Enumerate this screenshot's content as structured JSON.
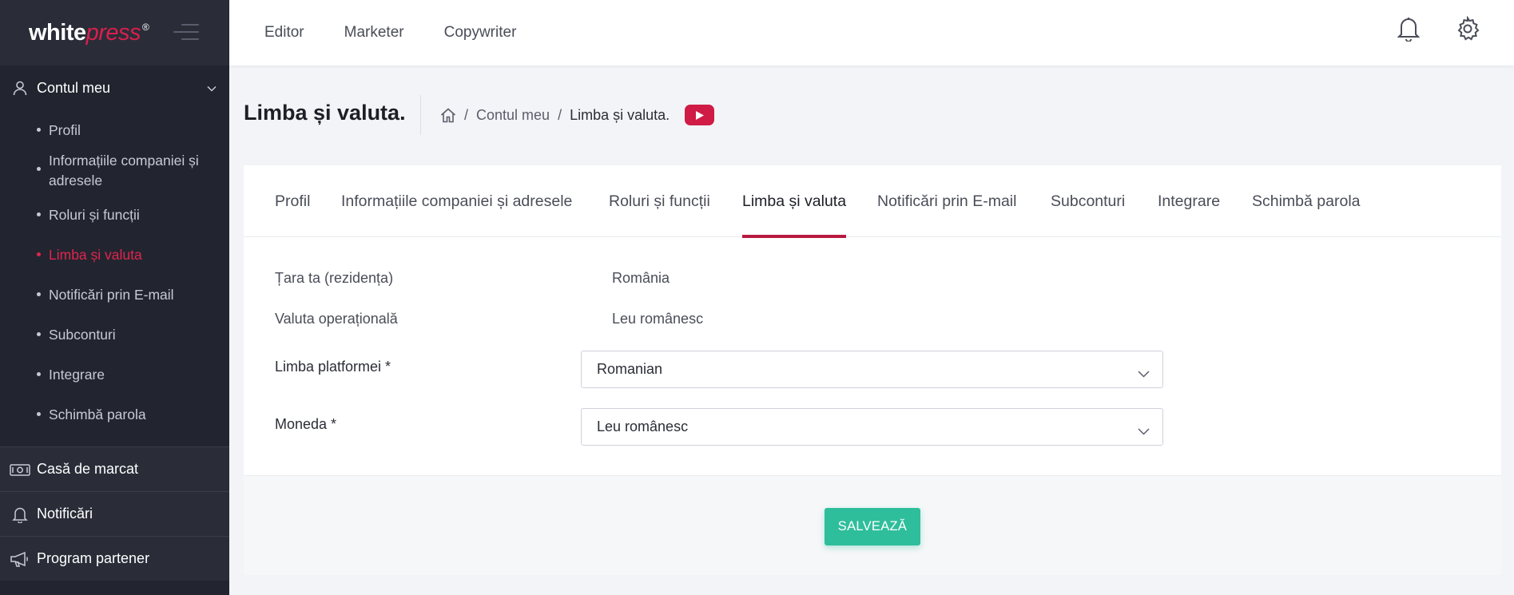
{
  "logo": {
    "white": "white",
    "press": "press",
    "reg": "®"
  },
  "sidebar": {
    "account_label": "Contul meu",
    "items": [
      {
        "label": "Profil",
        "active": false
      },
      {
        "label": "Informațiile companiei și adresele",
        "active": false
      },
      {
        "label": "Roluri și funcții",
        "active": false
      },
      {
        "label": "Limba și valuta",
        "active": true
      },
      {
        "label": "Notificări prin E-mail",
        "active": false
      },
      {
        "label": "Subconturi",
        "active": false
      },
      {
        "label": "Integrare",
        "active": false
      },
      {
        "label": "Schimbă parola",
        "active": false
      }
    ],
    "sections": [
      {
        "label": "Casă de marcat",
        "icon": "cash-register-icon"
      },
      {
        "label": "Notificări",
        "icon": "bell-icon"
      },
      {
        "label": "Program partener",
        "icon": "megaphone-icon"
      }
    ]
  },
  "topbar": {
    "nav": [
      "Editor",
      "Marketer",
      "Copywriter"
    ],
    "icons": [
      "bell-icon",
      "gear-icon"
    ]
  },
  "page": {
    "title": "Limba și valuta.",
    "breadcrumb": {
      "home_icon": "home-icon",
      "parent": "Contul meu",
      "current": "Limba și valuta.",
      "sep": "/"
    },
    "video_icon": "youtube-icon"
  },
  "tabs": [
    {
      "label": "Profil",
      "active": false
    },
    {
      "label": "Informațiile companiei și adresele",
      "active": false
    },
    {
      "label": "Roluri și funcții",
      "active": false
    },
    {
      "label": "Limba și valuta",
      "active": true
    },
    {
      "label": "Notificări prin E-mail",
      "active": false
    },
    {
      "label": "Subconturi",
      "active": false
    },
    {
      "label": "Integrare",
      "active": false
    },
    {
      "label": "Schimbă parola",
      "active": false
    }
  ],
  "form": {
    "country_label": "Țara ta (rezidența)",
    "country_value": "România",
    "currency_op_label": "Valuta operațională",
    "currency_op_value": "Leu românesc",
    "platform_lang_label": "Limba platformei *",
    "platform_lang_value": "Romanian",
    "coin_label": "Moneda *",
    "coin_value": "Leu românesc",
    "save_label": "SALVEAZĂ"
  },
  "colors": {
    "accent": "#d91f4d",
    "tab_underline": "#b8193f",
    "save_button": "#2fbe9c",
    "sidebar_bg": "#22252f"
  }
}
